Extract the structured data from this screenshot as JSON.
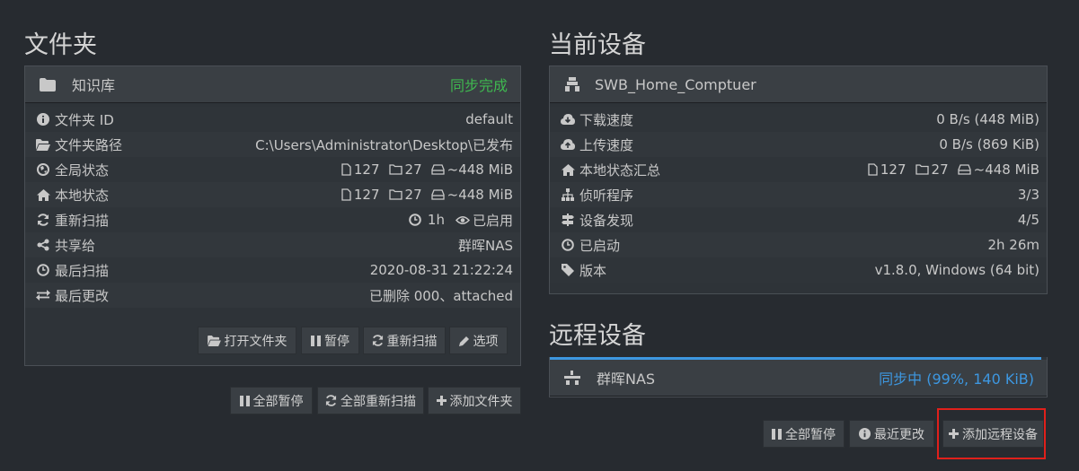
{
  "folders": {
    "heading": "文件夹",
    "panel": {
      "title": "知识库",
      "status": "同步完成",
      "status_color": "#3fb950",
      "rows": [
        {
          "icon": "info-icon",
          "label": "文件夹 ID",
          "value": "default"
        },
        {
          "icon": "folder-open-icon",
          "label": "文件夹路径",
          "value": "C:\\Users\\Administrator\\Desktop\\已发布"
        },
        {
          "icon": "globe-icon",
          "label": "全局状态",
          "files": "127",
          "dirs": "27",
          "size": "~448 MiB"
        },
        {
          "icon": "home-icon",
          "label": "本地状态",
          "files": "127",
          "dirs": "27",
          "size": "~448 MiB"
        },
        {
          "icon": "refresh-icon",
          "label": "重新扫描",
          "interval": "1h",
          "enabled": "已启用"
        },
        {
          "icon": "share-icon",
          "label": "共享给",
          "value": "群晖NAS"
        },
        {
          "icon": "clock-icon",
          "label": "最后扫描",
          "value": "2020-08-31 21:22:24"
        },
        {
          "icon": "exchange-icon",
          "label": "最后更改",
          "value": "已删除 000、attached"
        }
      ],
      "buttons": {
        "open": "打开文件夹",
        "pause": "暂停",
        "rescan": "重新扫描",
        "options": "选项"
      }
    },
    "actions": {
      "pause_all": "全部暂停",
      "rescan_all": "全部重新扫描",
      "add_folder": "添加文件夹"
    }
  },
  "this_device": {
    "heading": "当前设备",
    "name": "SWB_Home_Comptuer",
    "rows": [
      {
        "icon": "cloud-download-icon",
        "label": "下载速度",
        "value": "0 B/s (448 MiB)"
      },
      {
        "icon": "cloud-upload-icon",
        "label": "上传速度",
        "value": "0 B/s (869 KiB)"
      },
      {
        "icon": "home-icon",
        "label": "本地状态汇总",
        "files": "127",
        "dirs": "27",
        "size": "~448 MiB"
      },
      {
        "icon": "sitemap-icon",
        "label": "侦听程序",
        "value": "3/3"
      },
      {
        "icon": "signpost-icon",
        "label": "设备发现",
        "value": "4/5"
      },
      {
        "icon": "clock-icon",
        "label": "已启动",
        "value": "2h 26m"
      },
      {
        "icon": "tag-icon",
        "label": "版本",
        "value": "v1.8.0, Windows (64 bit)"
      }
    ]
  },
  "remote_devices": {
    "heading": "远程设备",
    "device": {
      "name": "群晖NAS",
      "status": "同步中 (99%, 140 KiB)",
      "progress": 0.99
    },
    "actions": {
      "pause_all": "全部暂停",
      "recent_changes": "最近更改",
      "add_remote": "添加远程设备"
    }
  }
}
